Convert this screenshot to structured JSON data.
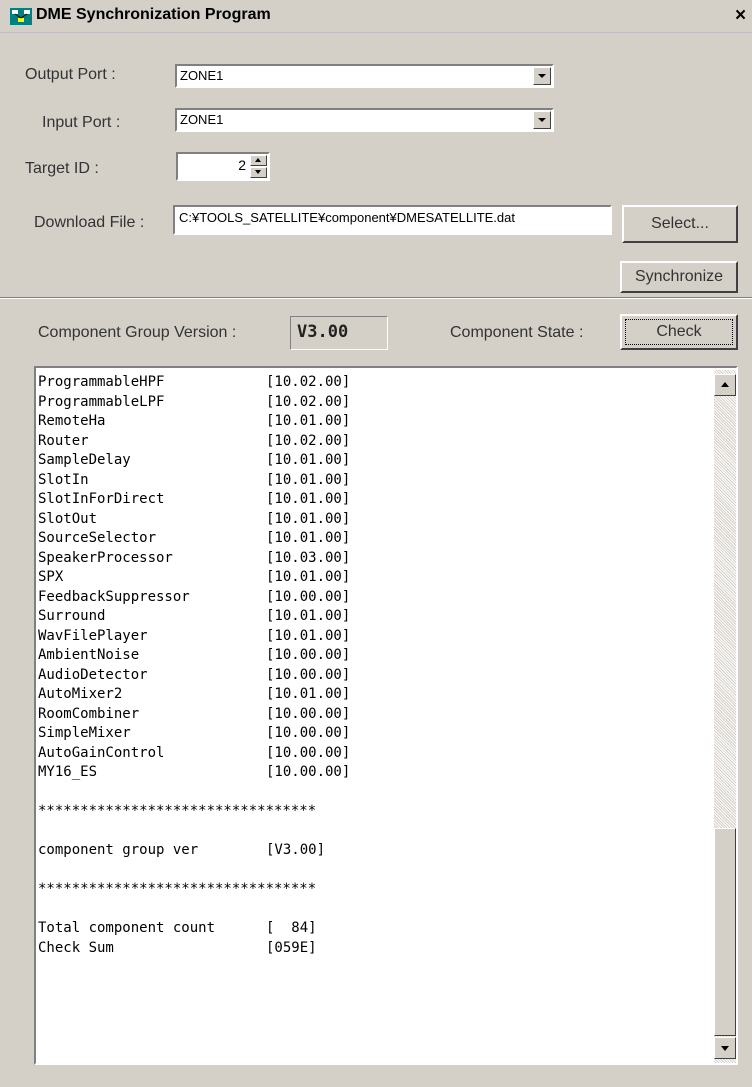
{
  "window": {
    "title": "DME Synchronization Program",
    "close_glyph": "×",
    "icon": "app-network-icon"
  },
  "output_port": {
    "label": "Output Port :",
    "value": "ZONE1"
  },
  "input_port": {
    "label": "Input Port :",
    "value": "ZONE1"
  },
  "target_id": {
    "label": "Target ID :",
    "value": "2"
  },
  "download_file": {
    "label": "Download File :",
    "value": "C:¥TOOLS_SATELLITE¥component¥DMESATELLITE.dat",
    "select_button": "Select..."
  },
  "synchronize_button": "Synchronize",
  "component_group_version": {
    "label": "Component Group Version :",
    "value": "V3.00"
  },
  "component_state": {
    "label": "Component State :",
    "check_button": "Check"
  },
  "list": {
    "components": [
      {
        "name": "ProgrammableHPF",
        "version": "[10.02.00]"
      },
      {
        "name": "ProgrammableLPF",
        "version": "[10.02.00]"
      },
      {
        "name": "RemoteHa",
        "version": "[10.01.00]"
      },
      {
        "name": "Router",
        "version": "[10.02.00]"
      },
      {
        "name": "SampleDelay",
        "version": "[10.01.00]"
      },
      {
        "name": "SlotIn",
        "version": "[10.01.00]"
      },
      {
        "name": "SlotInForDirect",
        "version": "[10.01.00]"
      },
      {
        "name": "SlotOut",
        "version": "[10.01.00]"
      },
      {
        "name": "SourceSelector",
        "version": "[10.01.00]"
      },
      {
        "name": "SpeakerProcessor",
        "version": "[10.03.00]"
      },
      {
        "name": "SPX",
        "version": "[10.01.00]"
      },
      {
        "name": "FeedbackSuppressor",
        "version": "[10.00.00]"
      },
      {
        "name": "Surround",
        "version": "[10.01.00]"
      },
      {
        "name": "WavFilePlayer",
        "version": "[10.01.00]"
      },
      {
        "name": "AmbientNoise",
        "version": "[10.00.00]"
      },
      {
        "name": "AudioDetector",
        "version": "[10.00.00]"
      },
      {
        "name": "AutoMixer2",
        "version": "[10.01.00]"
      },
      {
        "name": "RoomCombiner",
        "version": "[10.00.00]"
      },
      {
        "name": "SimpleMixer",
        "version": "[10.00.00]"
      },
      {
        "name": "AutoGainControl",
        "version": "[10.00.00]"
      },
      {
        "name": "MY16_ES",
        "version": "[10.00.00]"
      }
    ],
    "separator": "*********************************",
    "group_ver": {
      "name": "component group ver",
      "value": "[V3.00]"
    },
    "total_count": {
      "name": "Total component count",
      "value": "[  84]"
    },
    "check_sum": {
      "name": "Check Sum",
      "value": "[059E]"
    }
  },
  "scrollbar": {
    "position": 1.0
  }
}
